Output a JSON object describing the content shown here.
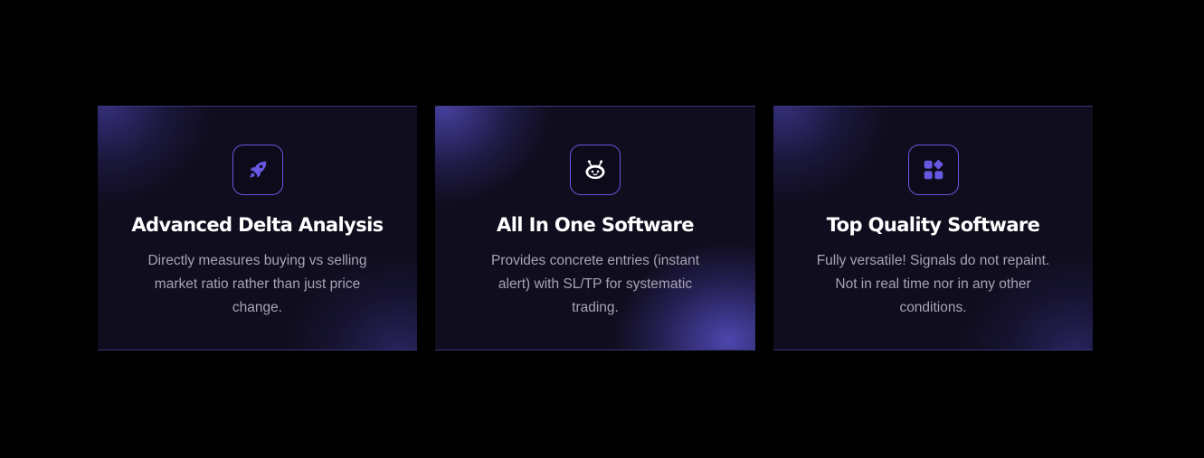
{
  "colors": {
    "background": "#000000",
    "card_background": "#100d1e",
    "accent": "#6658e0",
    "title": "#ffffff",
    "description": "#a6a4b4"
  },
  "features": [
    {
      "icon": "rocket-icon",
      "title": "Advanced Delta Analysis",
      "description": "Directly measures buying vs selling market ratio rather than just price change."
    },
    {
      "icon": "robot-icon",
      "title": "All In One Software",
      "description": "Provides concrete entries (instant alert) with SL/TP for systematic trading."
    },
    {
      "icon": "apps-grid-icon",
      "title": "Top Quality Software",
      "description": "Fully versatile! Signals do not repaint. Not in real time nor in any other conditions."
    }
  ]
}
